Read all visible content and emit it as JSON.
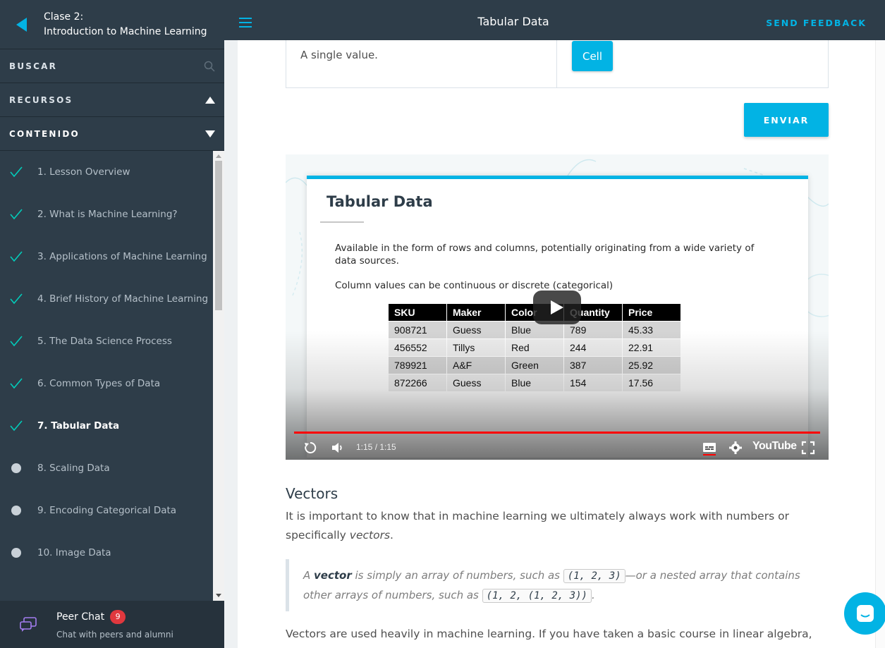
{
  "sidebar": {
    "course_line1": "Clase 2:",
    "course_line2": "Introduction to Machine Learning",
    "search_label": "BUSCAR",
    "resources_label": "RECURSOS",
    "content_label": "CONTENIDO",
    "items": [
      {
        "label": "1. Lesson Overview",
        "status": "done"
      },
      {
        "label": "2. What is Machine Learning?",
        "status": "done"
      },
      {
        "label": "3. Applications of Machine Learning",
        "status": "done"
      },
      {
        "label": "4. Brief History of Machine Learning",
        "status": "done"
      },
      {
        "label": "5. The Data Science Process",
        "status": "done"
      },
      {
        "label": "6. Common Types of Data",
        "status": "done"
      },
      {
        "label": "7. Tabular Data",
        "status": "current"
      },
      {
        "label": "8. Scaling Data",
        "status": "pending"
      },
      {
        "label": "9. Encoding Categorical Data",
        "status": "pending"
      },
      {
        "label": "10. Image Data",
        "status": "pending"
      }
    ],
    "peer_chat": {
      "title": "Peer Chat",
      "badge": "9",
      "subtitle": "Chat with peers and alumni"
    }
  },
  "topbar": {
    "title": "Tabular Data",
    "feedback": "SEND FEEDBACK"
  },
  "quiz": {
    "definition": "A single value.",
    "answer": "Cell",
    "submit": "ENVIAR"
  },
  "video": {
    "slide_title": "Tabular Data",
    "line1": "Available in the form of rows and columns, potentially originating from a wide variety of data sources.",
    "line2": "Column values can be continuous or discrete (categorical)",
    "columns": [
      "SKU",
      "Maker",
      "Color",
      "Quantity",
      "Price"
    ],
    "rows": [
      [
        "908721",
        "Guess",
        "Blue",
        "789",
        "45.33"
      ],
      [
        "456552",
        "Tillys",
        "Red",
        "244",
        "22.91"
      ],
      [
        "789921",
        "A&F",
        "Green",
        "387",
        "25.92"
      ],
      [
        "872266",
        "Guess",
        "Blue",
        "154",
        "17.56"
      ]
    ],
    "time": "1:15 / 1:15",
    "brand": "YouTube",
    "progress": 1.0
  },
  "article": {
    "heading": "Vectors",
    "p1": "It is important to know that in machine learning we ultimately always work with numbers or specifically",
    "p1_em": "vectors",
    "p1_end": ".",
    "q_a": "A ",
    "q_strong": "vector",
    "q_b": " is simply an array of numbers, such as ",
    "q_code1": "(1, 2, 3)",
    "q_c": "—or a nested array that contains other arrays of numbers, such as ",
    "q_code2": "(1, 2, (1, 2, 3))",
    "q_d": ".",
    "p2": "Vectors are used heavily in machine learning. If you have taken a basic course in linear algebra, then"
  },
  "colors": {
    "accent": "#02b3e4",
    "sidebar_bg": "#2e3d49",
    "check": "#02ccba",
    "progress": "#ff0000"
  }
}
